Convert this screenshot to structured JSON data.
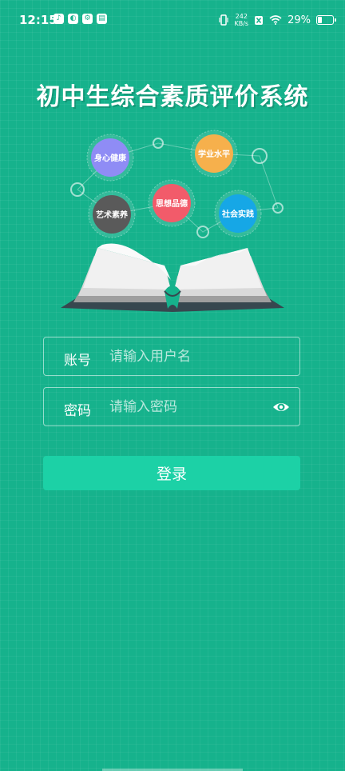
{
  "status_bar": {
    "time": "12:15",
    "net_speed_value": "242",
    "net_speed_unit": "KB/s",
    "battery_percent": "29%",
    "battery_level": 0.29,
    "notification_icons": [
      "tiktok-icon",
      "app-icon",
      "settings-icon",
      "news-icon"
    ]
  },
  "app": {
    "title": "初中生综合素质评价系统"
  },
  "illustration": {
    "bubbles": [
      {
        "label": "身心健康",
        "color": "#8f8cf5"
      },
      {
        "label": "学业水平",
        "color": "#f6b04c"
      },
      {
        "label": "思想品德",
        "color": "#f25b6a"
      },
      {
        "label": "艺术素养",
        "color": "#5a5a5a"
      },
      {
        "label": "社会实践",
        "color": "#16a7e6"
      }
    ]
  },
  "login_form": {
    "username_label": "账号",
    "username_placeholder": "请输入用户名",
    "username_value": "",
    "password_label": "密码",
    "password_placeholder": "请输入密码",
    "password_value": "",
    "login_button": "登录"
  },
  "colors": {
    "background": "#16b28c",
    "button": "#1cd1a6"
  }
}
